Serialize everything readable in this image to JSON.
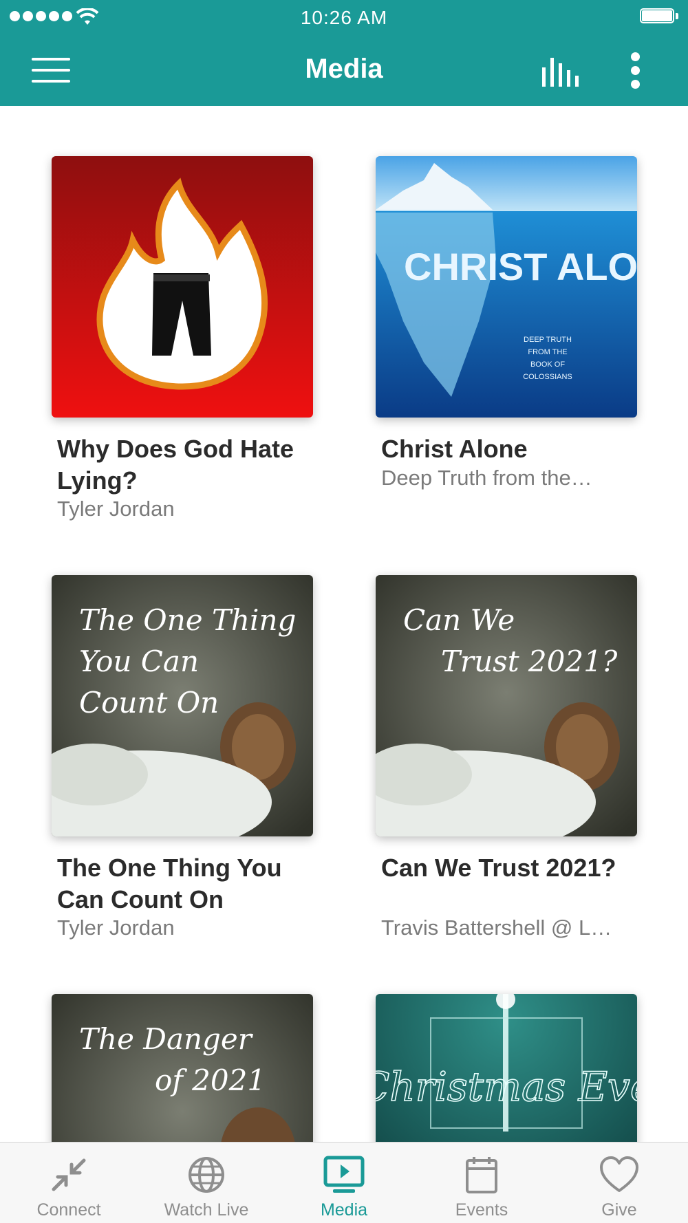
{
  "status_bar": {
    "time": "10:26 AM"
  },
  "app_bar": {
    "title": "Media",
    "menu_icon": "hamburger-menu-icon",
    "chart_icon": "bar-chart-icon",
    "more_icon": "more-vertical-icon"
  },
  "media": {
    "items": [
      {
        "title": "Why Does God Hate Lying?",
        "subtitle": "Tyler Jordan",
        "artwork": "flame with black pants on red background"
      },
      {
        "title": "Christ Alone",
        "subtitle": "Deep Truth from the…",
        "artwork": "iceberg under water",
        "art_text": {
          "big": "CHRIST ALONE",
          "small": [
            "DEEP TRUTH",
            "FROM THE",
            "BOOK OF",
            "COLOSSIANS"
          ]
        }
      },
      {
        "title": "The One Thing You Can Count On",
        "subtitle": "Tyler Jordan",
        "artwork": "pine cone with snowy branches",
        "art_text": [
          "The One Thing",
          "You Can",
          "Count On"
        ]
      },
      {
        "title": "Can We Trust 2021?",
        "subtitle": "Travis Battershell @ L…",
        "artwork": "pine cone with snowy branches",
        "art_text": [
          "Can We",
          "Trust 2021?"
        ]
      },
      {
        "title": "",
        "subtitle": "",
        "artwork": "pine cone with snowy branches",
        "art_text": [
          "The Danger",
          "of 2021"
        ]
      },
      {
        "title": "",
        "subtitle": "",
        "artwork": "teal night sky with star beam",
        "art_text": [
          "Christmas Eve"
        ]
      }
    ]
  },
  "tab_bar": {
    "active": "Media",
    "accent_color": "#1a9a97",
    "tabs": [
      {
        "label": "Connect",
        "icon": "compress-arrows-icon"
      },
      {
        "label": "Watch Live",
        "icon": "globe-icon"
      },
      {
        "label": "Media",
        "icon": "tv-play-icon"
      },
      {
        "label": "Events",
        "icon": "calendar-icon"
      },
      {
        "label": "Give",
        "icon": "heart-icon"
      }
    ]
  },
  "colors": {
    "header": "#1a9a97",
    "title_text": "#2b2b2b",
    "subtitle_text": "#7a7a7a"
  }
}
